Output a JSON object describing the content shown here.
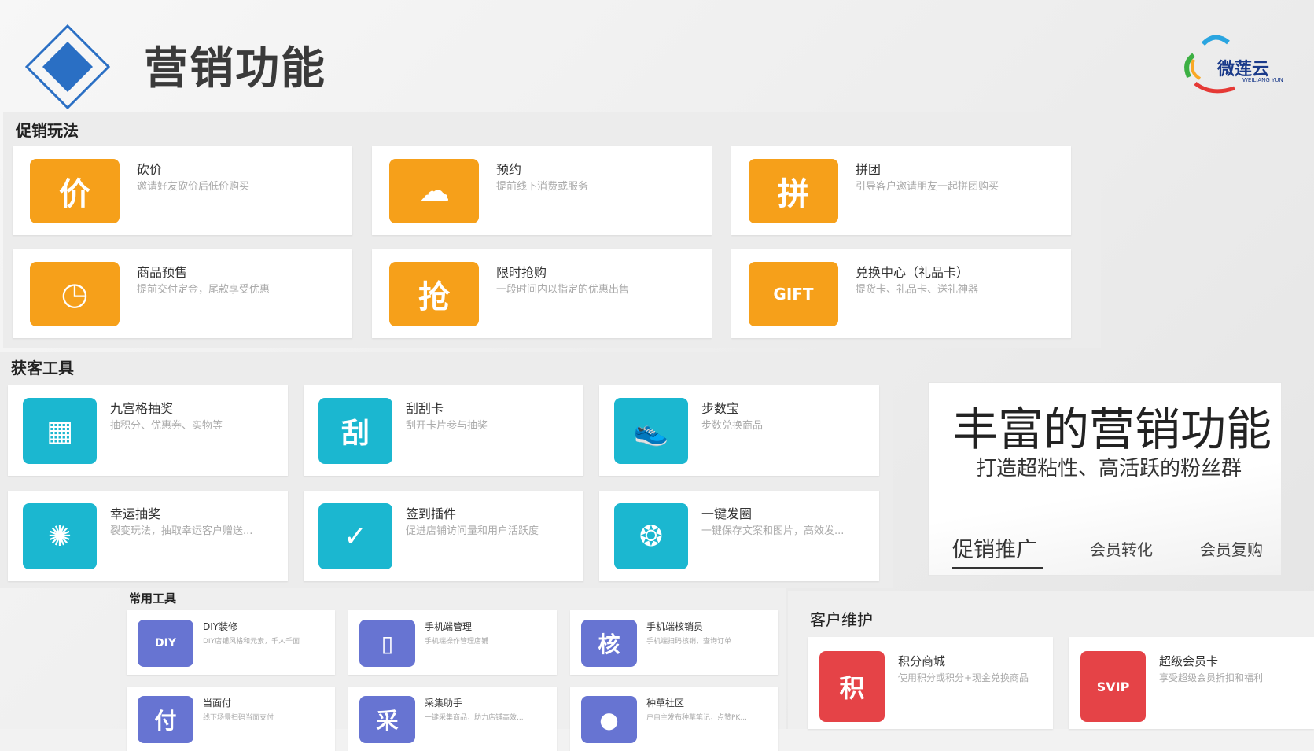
{
  "header": {
    "title": "营销功能",
    "logo_text": "微莲云",
    "logo_subtext": "WEILIANG YUN"
  },
  "colors": {
    "orange": "#f6a01a",
    "teal": "#1bb7d0",
    "purple": "#6774d2",
    "red": "#e54347",
    "diamond": "#2a6fc4"
  },
  "promotion": {
    "title": "促销玩法",
    "items": [
      {
        "title": "砍价",
        "desc": "邀请好友砍价后低价购买",
        "icon": "kanjia-icon",
        "glyph": "价"
      },
      {
        "title": "预约",
        "desc": "提前线下消费或服务",
        "icon": "cloud-icon",
        "glyph": "☁"
      },
      {
        "title": "拼团",
        "desc": "引导客户邀请朋友一起拼团购买",
        "icon": "group-buy-icon",
        "glyph": "拼"
      },
      {
        "title": "商品预售",
        "desc": "提前交付定金，尾款享受优惠",
        "icon": "presale-bag-icon",
        "glyph": "◷"
      },
      {
        "title": "限时抢购",
        "desc": "一段时间内以指定的优惠出售",
        "icon": "flash-sale-icon",
        "glyph": "抢"
      },
      {
        "title": "兑换中心（礼品卡）",
        "desc": "提货卡、礼品卡、送礼神器",
        "icon": "gift-card-icon",
        "glyph": "GIFT"
      }
    ]
  },
  "acquisition": {
    "title": "获客工具",
    "items": [
      {
        "title": "九宫格抽奖",
        "desc": "抽积分、优惠券、实物等",
        "icon": "grid-lottery-icon",
        "glyph": "▦"
      },
      {
        "title": "刮刮卡",
        "desc": "刮开卡片参与抽奖",
        "icon": "scratch-card-icon",
        "glyph": "刮"
      },
      {
        "title": "步数宝",
        "desc": "步数兑换商品",
        "icon": "sneaker-icon",
        "glyph": "👟"
      },
      {
        "title": "幸运抽奖",
        "desc": "裂变玩法，抽取幸运客户赠送...",
        "icon": "lucky-wheel-icon",
        "glyph": "✺"
      },
      {
        "title": "签到插件",
        "desc": "促进店铺访问量和用户活跃度",
        "icon": "calendar-check-icon",
        "glyph": "✓"
      },
      {
        "title": "一键发圈",
        "desc": "一键保存文案和图片，高效发...",
        "icon": "aperture-icon",
        "glyph": "❂"
      }
    ]
  },
  "common_tools": {
    "title": "常用工具",
    "items": [
      {
        "title": "DIY装修",
        "desc": "DIY店铺风格和元素，千人千面",
        "icon": "diy-icon",
        "glyph": "DIY"
      },
      {
        "title": "手机端管理",
        "desc": "手机端操作管理店铺",
        "icon": "mobile-icon",
        "glyph": "▯"
      },
      {
        "title": "手机端核销员",
        "desc": "手机端扫码核销，查询订单",
        "icon": "verifier-icon",
        "glyph": "核"
      },
      {
        "title": "当面付",
        "desc": "线下场景扫码当面支付",
        "icon": "pay-icon",
        "glyph": "付"
      },
      {
        "title": "采集助手",
        "desc": "一键采集商品，助力店铺高效...",
        "icon": "collect-icon",
        "glyph": "采"
      },
      {
        "title": "种草社区",
        "desc": "户自主发布种草笔记，点赞PK...",
        "icon": "planet-icon",
        "glyph": "●"
      }
    ]
  },
  "customer": {
    "title": "客户维护",
    "items": [
      {
        "title": "积分商城",
        "desc": "使用积分或积分+现金兑换商品",
        "icon": "points-icon",
        "glyph": "积"
      },
      {
        "title": "超级会员卡",
        "desc": "享受超级会员折扣和福利",
        "icon": "svip-card-icon",
        "glyph": "SVIP"
      }
    ]
  },
  "promo": {
    "headline": "丰富的营销功能",
    "subline": "打造超粘性、高活跃的粉丝群",
    "tabs": [
      "促销推广",
      "会员转化",
      "会员复购"
    ]
  }
}
